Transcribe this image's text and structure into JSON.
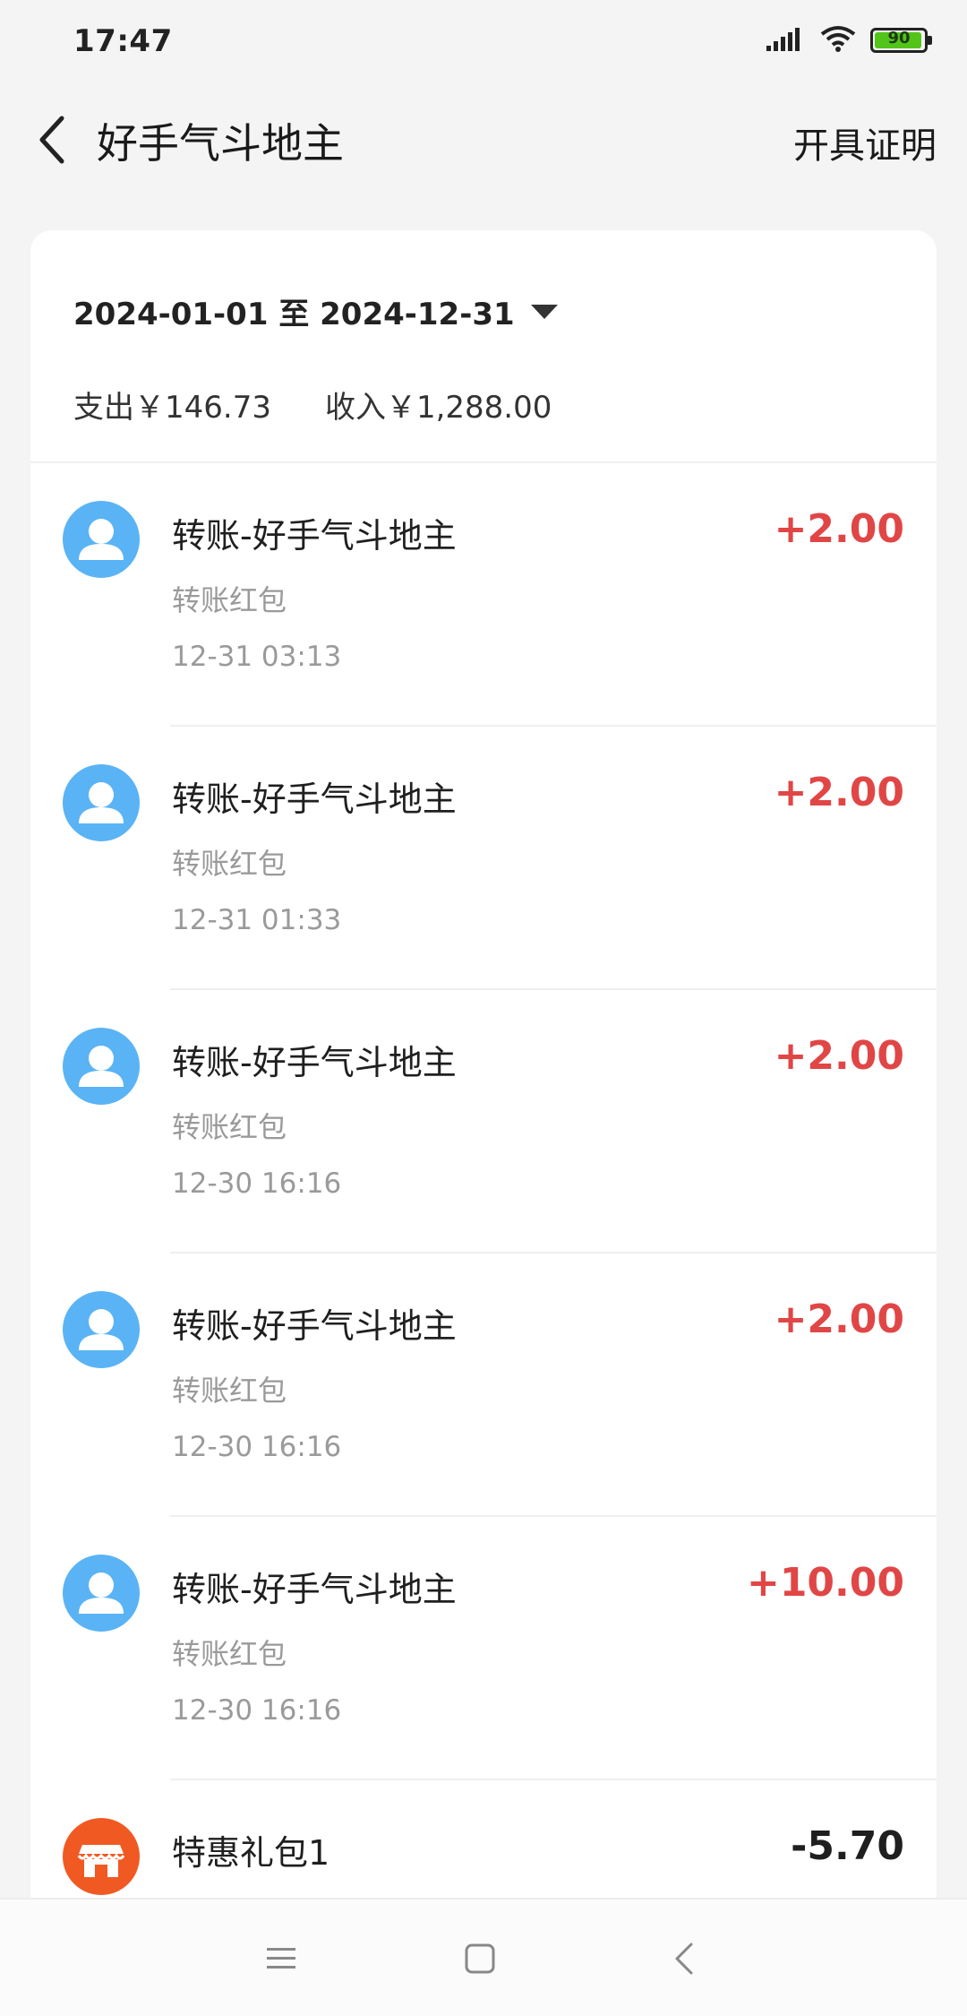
{
  "status_bar": {
    "time": "17:47",
    "battery_level": "90",
    "battery_fraction": 0.9
  },
  "nav": {
    "title": "好手气斗地主",
    "action": "开具证明"
  },
  "filter": {
    "date_range": "2024-01-01 至 2024-12-31"
  },
  "summary": {
    "expense": "支出￥146.73",
    "income": "收入￥1,288.00"
  },
  "transactions": [
    {
      "title": "转账-好手气斗地主",
      "subtitle": "转账红包",
      "time": "12-31 03:13",
      "amount": "+2.00",
      "icon": "user-avatar-icon"
    },
    {
      "title": "转账-好手气斗地主",
      "subtitle": "转账红包",
      "time": "12-31 01:33",
      "amount": "+2.00",
      "icon": "user-avatar-icon"
    },
    {
      "title": "转账-好手气斗地主",
      "subtitle": "转账红包",
      "time": "12-30 16:16",
      "amount": "+2.00",
      "icon": "user-avatar-icon"
    },
    {
      "title": "转账-好手气斗地主",
      "subtitle": "转账红包",
      "time": "12-30 16:16",
      "amount": "+2.00",
      "icon": "user-avatar-icon"
    },
    {
      "title": "转账-好手气斗地主",
      "subtitle": "转账红包",
      "time": "12-30 16:16",
      "amount": "+10.00",
      "icon": "user-avatar-icon"
    },
    {
      "title": "特惠礼包1",
      "amount": "-5.70",
      "icon": "store-icon"
    }
  ],
  "colors": {
    "income": "#e14646",
    "avatar_user": "#5ab3f5",
    "avatar_store": "#f05a22"
  },
  "system_nav": {
    "icons": [
      "menu-icon",
      "home-square-icon",
      "back-icon"
    ]
  }
}
